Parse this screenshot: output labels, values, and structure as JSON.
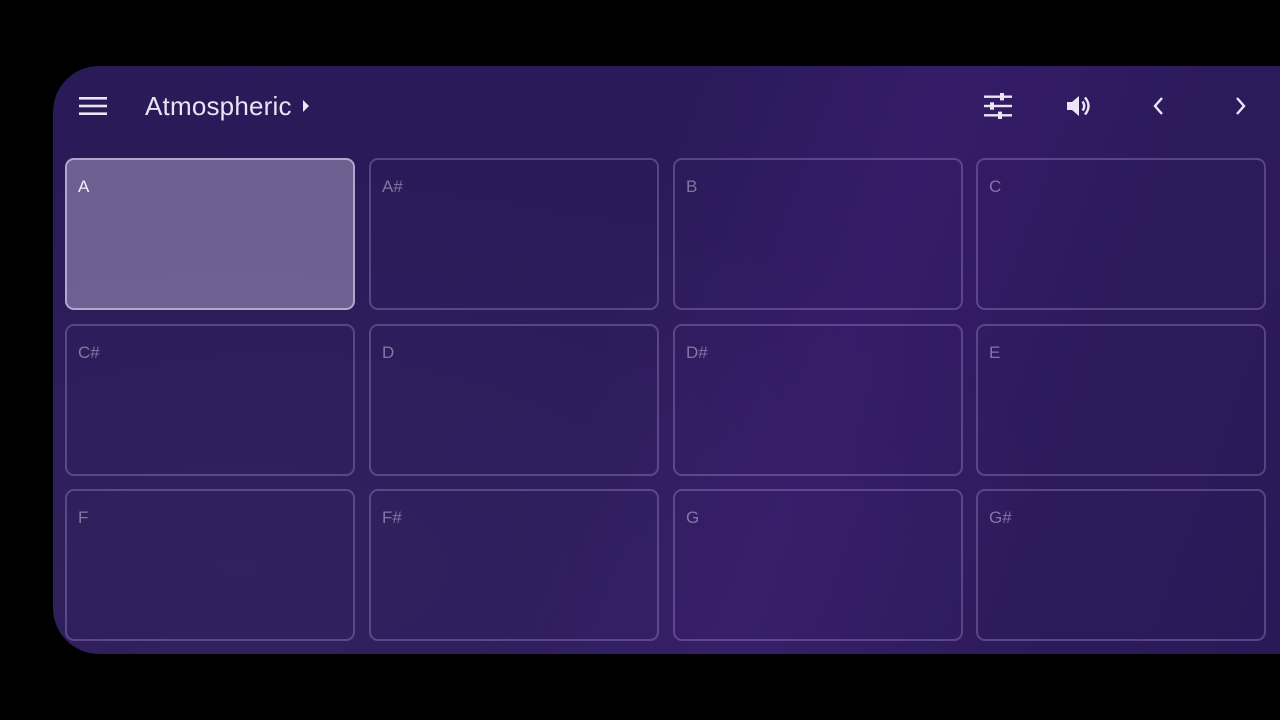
{
  "toolbar": {
    "menu_icon": "menu-icon",
    "title": "Atmospheric",
    "title_caret_icon": "caret-right-icon",
    "actions": [
      {
        "name": "tune-icon"
      },
      {
        "name": "volume-icon"
      },
      {
        "name": "chevron-left-icon"
      },
      {
        "name": "chevron-right-icon"
      }
    ]
  },
  "colors": {
    "background": "#000000",
    "panel": "#2b1a5a",
    "pad_border": "#6b5a8e",
    "pad_active": "#5e4f7e",
    "text": "#e9e4f3"
  },
  "pads": [
    {
      "label": "A",
      "active": true
    },
    {
      "label": "A#",
      "active": false
    },
    {
      "label": "B",
      "active": false
    },
    {
      "label": "C",
      "active": false
    },
    {
      "label": "C#",
      "active": false
    },
    {
      "label": "D",
      "active": false
    },
    {
      "label": "D#",
      "active": false
    },
    {
      "label": "E",
      "active": false
    },
    {
      "label": "F",
      "active": false
    },
    {
      "label": "F#",
      "active": false
    },
    {
      "label": "G",
      "active": false
    },
    {
      "label": "G#",
      "active": false
    }
  ]
}
